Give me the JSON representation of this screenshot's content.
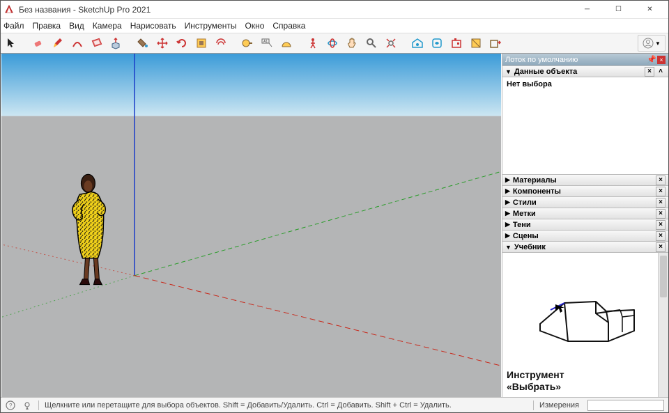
{
  "titlebar": {
    "title": "Без названия - SketchUp Pro 2021"
  },
  "menu": {
    "file": "Файл",
    "edit": "Правка",
    "view": "Вид",
    "camera": "Камера",
    "draw": "Нарисовать",
    "tools": "Инструменты",
    "window": "Окно",
    "help": "Справка"
  },
  "toolbar_icons": [
    "select-arrow",
    "eraser",
    "pencil",
    "arc",
    "rectangle",
    "push-pull",
    "paint-bucket",
    "move-arrows",
    "rotate",
    "scale",
    "offset",
    "tape-measure",
    "text-label",
    "protractor",
    "walk",
    "orbit",
    "pan",
    "zoom",
    "zoom-extents",
    "warehouse",
    "extension-warehouse",
    "extension-manager",
    "layout",
    "send"
  ],
  "tray": {
    "title": "Лоток по умолчанию",
    "entity_info": {
      "label": "Данные объекта",
      "content": "Нет выбора"
    },
    "panels": [
      {
        "label": "Материалы"
      },
      {
        "label": "Компоненты"
      },
      {
        "label": "Стили"
      },
      {
        "label": "Метки"
      },
      {
        "label": "Тени"
      },
      {
        "label": "Сцены"
      }
    ],
    "instructor": {
      "label": "Учебник",
      "title_line1": "Инструмент",
      "title_line2": "«Выбрать»"
    }
  },
  "statusbar": {
    "hint": "Щелкните или перетащите для выбора объектов. Shift = Добавить/Удалить. Ctrl = Добавить. Shift + Ctrl = Удалить.",
    "measure_label": "Измерения"
  }
}
